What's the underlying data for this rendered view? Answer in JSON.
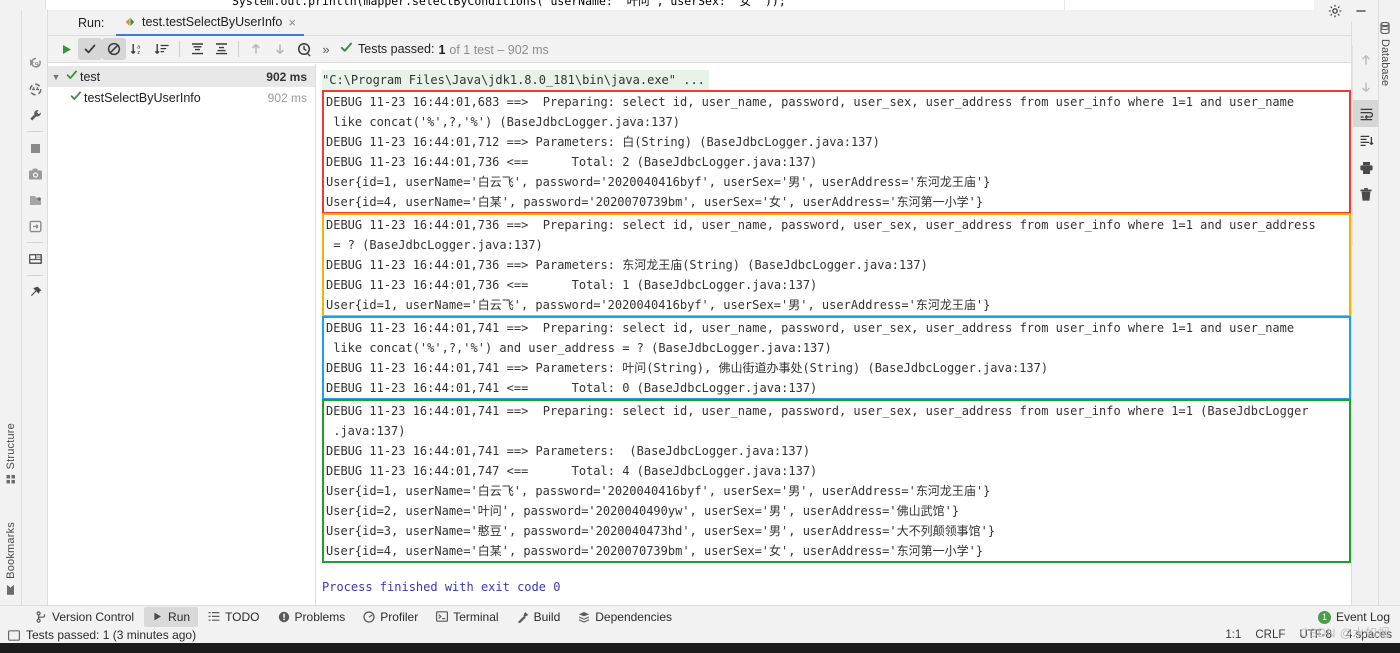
{
  "editor": {
    "code_line": "System.out.println(mapper.selectByConditions( userName: \"叶问\", userSex: \"女\" ));"
  },
  "run_window": {
    "label": "Run:",
    "tab_name": "test.testSelectByUserInfo",
    "tab_icon": "run-config-icon",
    "close_icon": "close-icon",
    "toolbar": {
      "rerun_label": "rerun-icon",
      "show_passed_label": "show-passed-icon",
      "hide_ignored_label": "hide-ignored-icon",
      "sort_alpha_label": "sort-alphabetically-icon",
      "sort_duration_label": "sort-by-duration-icon",
      "expand_all_label": "expand-all-icon",
      "collapse_all_label": "collapse-all-icon",
      "prev_label": "prev-failed-icon",
      "next_label": "next-failed-icon",
      "history_label": "history-icon",
      "more_label": "»"
    },
    "status": {
      "prefix": "Tests passed:",
      "count": "1",
      "suffix": "of 1 test – 902 ms",
      "check_icon": "check-icon"
    }
  },
  "test_tree": {
    "rows": [
      {
        "name": "test",
        "duration": "902 ms",
        "level": 0,
        "expanded": true,
        "status_icon": "check-icon",
        "selected": true
      },
      {
        "name": "testSelectByUserInfo",
        "duration": "902 ms",
        "level": 1,
        "expanded": false,
        "status_icon": "check-icon",
        "selected": false
      }
    ]
  },
  "console": {
    "command_line": "\"C:\\Program Files\\Java\\jdk1.8.0_181\\bin\\java.exe\" ...",
    "groups": [
      {
        "color": "#ef3b35",
        "color_name": "red",
        "lines": [
          "DEBUG 11-23 16:44:01,683 ==>  Preparing: select id, user_name, password, user_sex, user_address from user_info where 1=1 and user_name",
          " like concat('%',?,'%') (BaseJdbcLogger.java:137)",
          "DEBUG 11-23 16:44:01,712 ==> Parameters: 白(String) (BaseJdbcLogger.java:137)",
          "DEBUG 11-23 16:44:01,736 <==      Total: 2 (BaseJdbcLogger.java:137)",
          "User{id=1, userName='白云飞', password='2020040416byf', userSex='男', userAddress='东河龙王庙'}",
          "User{id=4, userName='白某', password='2020070739bm', userSex='女', userAddress='东河第一小学'}"
        ]
      },
      {
        "color": "#f5b100",
        "color_name": "yellow",
        "lines": [
          "DEBUG 11-23 16:44:01,736 ==>  Preparing: select id, user_name, password, user_sex, user_address from user_info where 1=1 and user_address",
          " = ? (BaseJdbcLogger.java:137)",
          "DEBUG 11-23 16:44:01,736 ==> Parameters: 东河龙王庙(String) (BaseJdbcLogger.java:137)",
          "DEBUG 11-23 16:44:01,736 <==      Total: 1 (BaseJdbcLogger.java:137)",
          "User{id=1, userName='白云飞', password='2020040416byf', userSex='男', userAddress='东河龙王庙'}"
        ]
      },
      {
        "color": "#1e9fe8",
        "color_name": "blue",
        "lines": [
          "DEBUG 11-23 16:44:01,741 ==>  Preparing: select id, user_name, password, user_sex, user_address from user_info where 1=1 and user_name",
          " like concat('%',?,'%') and user_address = ? (BaseJdbcLogger.java:137)",
          "DEBUG 11-23 16:44:01,741 ==> Parameters: 叶问(String), 佛山街道办事处(String) (BaseJdbcLogger.java:137)",
          "DEBUG 11-23 16:44:01,741 <==      Total: 0 (BaseJdbcLogger.java:137)"
        ]
      },
      {
        "color": "#1aa22a",
        "color_name": "green",
        "lines": [
          "DEBUG 11-23 16:44:01,741 ==>  Preparing: select id, user_name, password, user_sex, user_address from user_info where 1=1 (BaseJdbcLogger",
          " .java:137)",
          "DEBUG 11-23 16:44:01,741 ==> Parameters:  (BaseJdbcLogger.java:137)",
          "DEBUG 11-23 16:44:01,747 <==      Total: 4 (BaseJdbcLogger.java:137)",
          "User{id=1, userName='白云飞', password='2020040416byf', userSex='男', userAddress='东河龙王庙'}",
          "User{id=2, userName='叶问', password='2020040490yw', userSex='男', userAddress='佛山武馆'}",
          "User{id=3, userName='憨豆', password='2020040473hd', userSex='男', userAddress='大不列颠领事馆'}",
          "User{id=4, userName='白某', password='2020070739bm', userSex='女', userAddress='东河第一小学'}"
        ]
      }
    ],
    "process_finished": "Process finished with exit code 0"
  },
  "console_side_actions": [
    {
      "name": "scroll-up-icon",
      "dim": true
    },
    {
      "name": "scroll-down-icon",
      "dim": true
    },
    {
      "name": "soft-wrap-icon",
      "selected": true
    },
    {
      "name": "scroll-to-end-icon",
      "selected": false
    },
    {
      "name": "print-icon",
      "selected": false
    },
    {
      "name": "clear-all-icon",
      "selected": false
    }
  ],
  "run_icon_column": [
    {
      "name": "rerun-failed-icon"
    },
    {
      "name": "rerun-tests-icon"
    },
    {
      "name": "settings-wrench-icon"
    },
    {
      "name": "stop-icon"
    },
    {
      "name": "screenshot-icon"
    },
    {
      "name": "export-test-results-icon"
    },
    {
      "name": "import-test-results-icon"
    },
    {
      "name": "layout-icon"
    },
    {
      "name": "pin-icon"
    }
  ],
  "left_rail_tabs": [
    {
      "label": "Structure",
      "icon": "structure-icon"
    },
    {
      "label": "Bookmarks",
      "icon": "bookmark-icon"
    }
  ],
  "right_rail_tabs": [
    {
      "label": "Database",
      "icon": "database-icon"
    }
  ],
  "window_controls": [
    {
      "name": "settings-gear-icon",
      "glyph": "gear"
    },
    {
      "name": "minimize-icon",
      "glyph": "minimize"
    }
  ],
  "bottom_tabs": [
    {
      "label": "Version Control",
      "icon": "branch-icon",
      "active": false
    },
    {
      "label": "Run",
      "icon": "run-icon",
      "active": true
    },
    {
      "label": "TODO",
      "icon": "todo-icon",
      "active": false
    },
    {
      "label": "Problems",
      "icon": "problems-icon",
      "active": false
    },
    {
      "label": "Profiler",
      "icon": "profiler-icon",
      "active": false
    },
    {
      "label": "Terminal",
      "icon": "terminal-icon",
      "active": false
    },
    {
      "label": "Build",
      "icon": "build-hammer-icon",
      "active": false
    },
    {
      "label": "Dependencies",
      "icon": "dependencies-icon",
      "active": false
    }
  ],
  "event_log": {
    "label": "Event Log",
    "count": "1"
  },
  "status_bar": {
    "message": "Tests passed: 1 (3 minutes ago)",
    "icon": "terminal-small-icon",
    "right": [
      "1:1",
      "CRLF",
      "UTF-8",
      "4 spaces"
    ],
    "watermark": "CSDN @水如烟"
  }
}
